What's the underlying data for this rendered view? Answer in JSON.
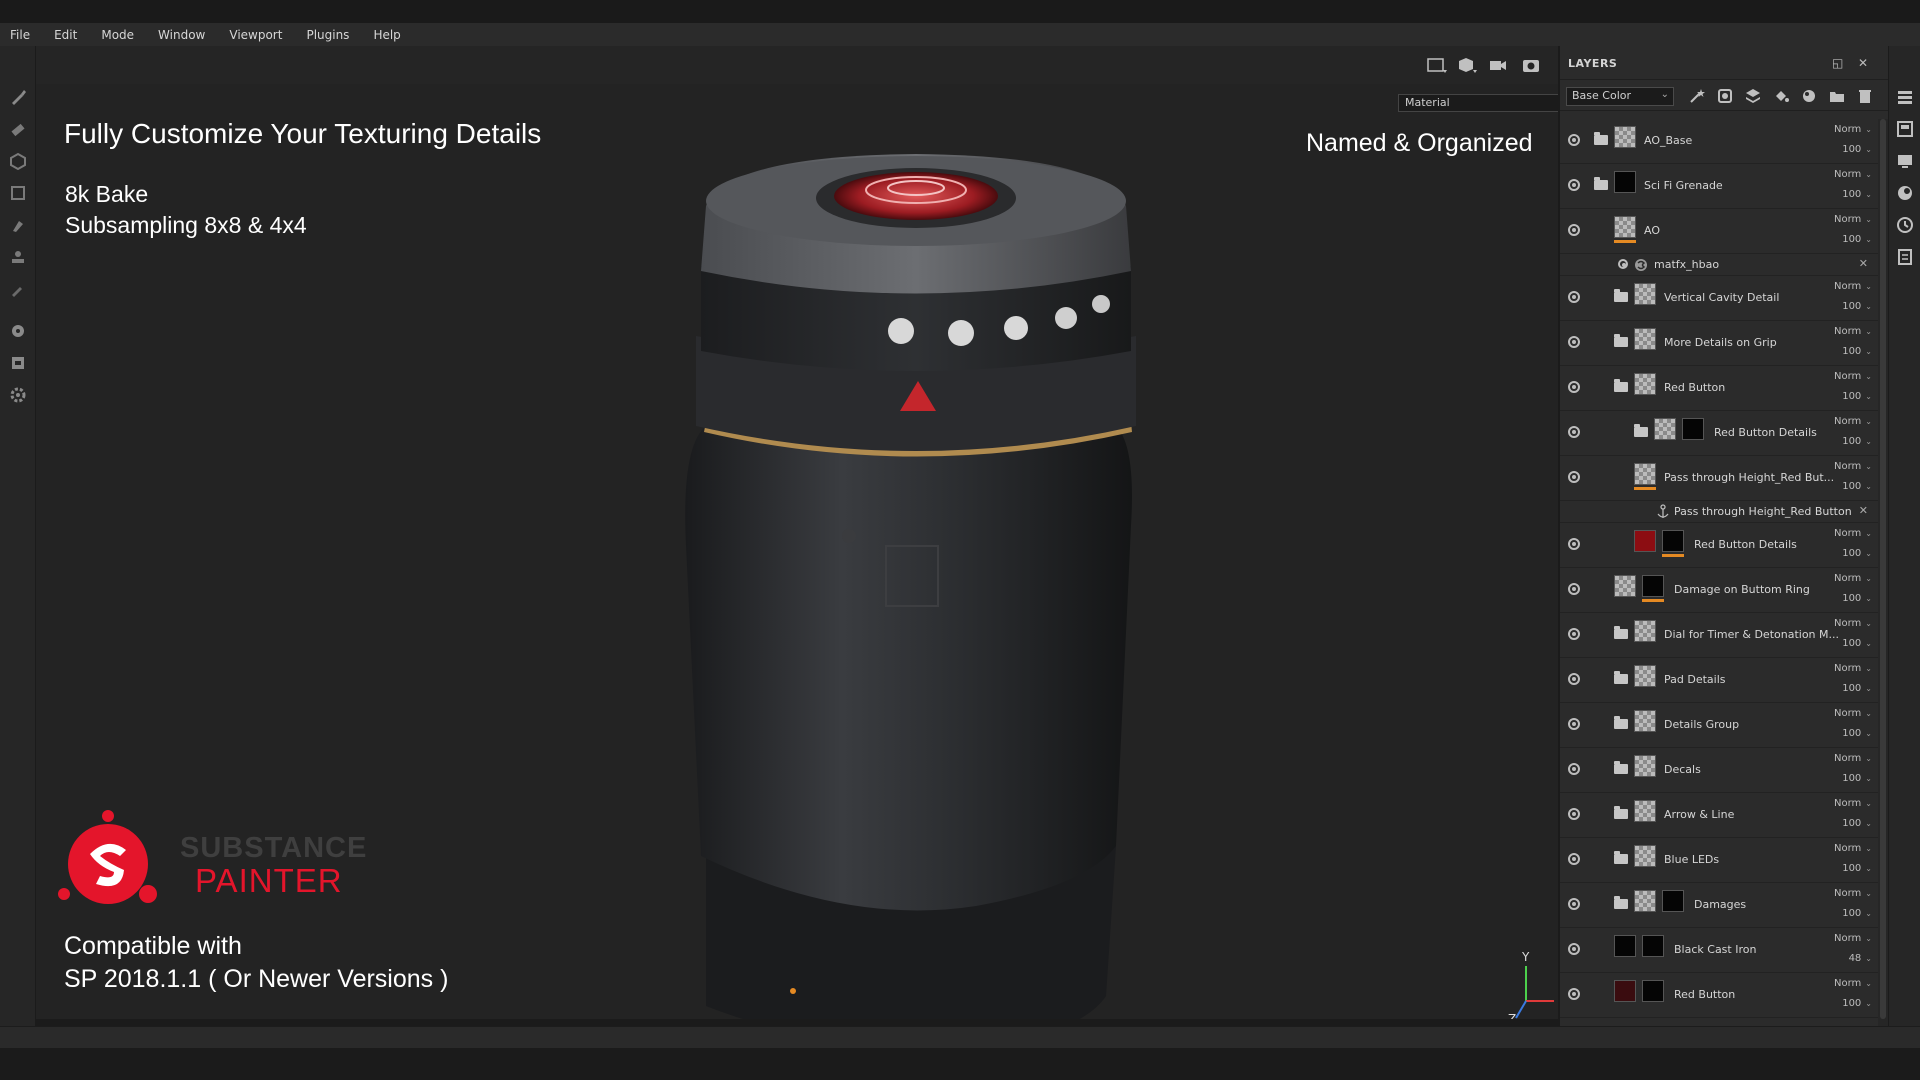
{
  "menu": [
    "File",
    "Edit",
    "Mode",
    "Window",
    "Viewport",
    "Plugins",
    "Help"
  ],
  "viewport": {
    "material_select": "Material",
    "overlay": {
      "title": "Fully Customize Your Texturing Details",
      "sub1": "8k Bake",
      "sub2": "Subsampling 8x8 & 4x4",
      "right": "Named & Organized",
      "compat1": "Compatible with",
      "compat2": "SP 2018.1.1 ( Or Newer Versions )"
    },
    "logo": {
      "line1": "SUBSTANCE",
      "line2": "PAINTER"
    },
    "axis": {
      "x": "X",
      "y": "Y",
      "z": "Z"
    }
  },
  "layers_panel": {
    "title": "LAYERS",
    "channel": "Base Color",
    "rows": [
      {
        "name": "AO_Base",
        "blend": "Norm",
        "opacity": "100",
        "folder": true
      },
      {
        "name": "Sci Fi Grenade",
        "blend": "Norm",
        "opacity": "100",
        "folder": true
      },
      {
        "name": "AO",
        "blend": "Norm",
        "opacity": "100",
        "folder": false
      },
      {
        "name": "matfx_hbao",
        "sub": true
      },
      {
        "name": "Vertical Cavity Detail",
        "blend": "Norm",
        "opacity": "100",
        "folder": true
      },
      {
        "name": "More Details on Grip",
        "blend": "Norm",
        "opacity": "100",
        "folder": true
      },
      {
        "name": "Red Button",
        "blend": "Norm",
        "opacity": "100",
        "folder": true
      },
      {
        "name": "Red Button Details",
        "blend": "Norm",
        "opacity": "100",
        "folder": true
      },
      {
        "name": "Pass through Height_Red But...",
        "blend": "Norm",
        "opacity": "100",
        "folder": false
      },
      {
        "name": "Pass through Height_Red Button",
        "sub": true
      },
      {
        "name": "Red Button Details",
        "blend": "Norm",
        "opacity": "100",
        "folder": false
      },
      {
        "name": "Damage on Buttom Ring",
        "blend": "Norm",
        "opacity": "100",
        "folder": false
      },
      {
        "name": "Dial for Timer & Detonation M...",
        "blend": "Norm",
        "opacity": "100",
        "folder": true
      },
      {
        "name": "Pad Details",
        "blend": "Norm",
        "opacity": "100",
        "folder": true
      },
      {
        "name": "Details Group",
        "blend": "Norm",
        "opacity": "100",
        "folder": true
      },
      {
        "name": "Decals",
        "blend": "Norm",
        "opacity": "100",
        "folder": true
      },
      {
        "name": "Arrow & Line",
        "blend": "Norm",
        "opacity": "100",
        "folder": true
      },
      {
        "name": "Blue LEDs",
        "blend": "Norm",
        "opacity": "100",
        "folder": true
      },
      {
        "name": "Damages",
        "blend": "Norm",
        "opacity": "100",
        "folder": true
      },
      {
        "name": "Black Cast Iron",
        "blend": "Norm",
        "opacity": "48",
        "folder": false
      },
      {
        "name": "Red Button",
        "blend": "Norm",
        "opacity": "100",
        "folder": false
      }
    ]
  },
  "colors": {
    "accent_orange": "#e58a23",
    "logo_red": "#e4152b"
  },
  "icons": {
    "left_tools": [
      "paint-brush-icon",
      "eraser-icon",
      "projection-icon",
      "polygon-fill-icon",
      "smudge-icon",
      "clone-stamp-icon",
      "color-picker-icon",
      "bake-icon",
      "export-icon",
      "settings-icon"
    ],
    "viewport_tools": [
      "2d-view-icon",
      "3d-view-icon",
      "camera-icon",
      "screenshot-icon"
    ],
    "layer_tools": [
      "magic-wand-icon",
      "add-mask-icon",
      "add-layer-icon",
      "fill-layer-icon",
      "smart-material-icon",
      "add-folder-icon",
      "delete-icon"
    ],
    "right_strip": [
      "layers-tab-icon",
      "texture-set-icon",
      "display-settings-icon",
      "shader-icon",
      "history-icon",
      "log-icon"
    ]
  }
}
